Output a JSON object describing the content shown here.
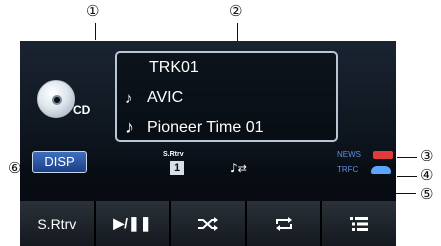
{
  "callouts": [
    "①",
    "②",
    "③",
    "④",
    "⑤",
    "⑥"
  ],
  "source": {
    "label": "CD",
    "icon": "cd-disc-icon"
  },
  "track_info": {
    "track": "TRK01",
    "artist": "AVIC",
    "title": "Pioneer Time 01",
    "artist_icon": "artist-icon",
    "title_icon": "music-note-icon"
  },
  "status": {
    "disp_label": "DISP",
    "srtrv_label": "S.Rtrv",
    "srtrv_value": "1",
    "news_label": "NEWS",
    "trfc_label": "TRFC"
  },
  "buttons": [
    {
      "label": "S.Rtrv",
      "icon": ""
    },
    {
      "label": "▶/❚❚",
      "icon": "play-pause-icon"
    },
    {
      "label": "",
      "icon": "shuffle-icon"
    },
    {
      "label": "",
      "icon": "repeat-icon"
    },
    {
      "label": "",
      "icon": "list-icon"
    }
  ],
  "colors": {
    "disp_button": "#2a56a8",
    "screen_bg": "#0b1118",
    "news_icon": "#e23b3b",
    "trfc_icon": "#5aa6ff"
  }
}
